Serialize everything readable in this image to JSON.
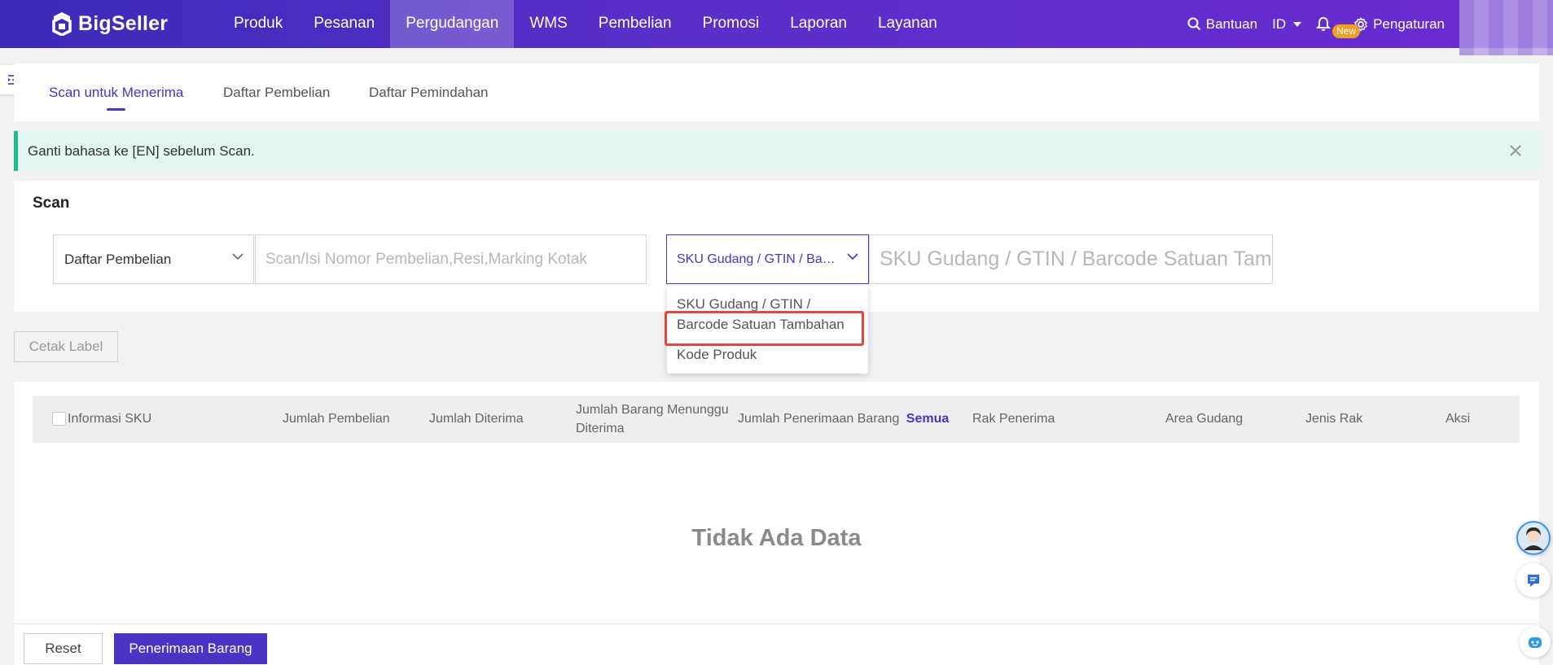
{
  "app": {
    "logo_text": "BigSeller"
  },
  "nav": {
    "items": [
      {
        "label": "Produk"
      },
      {
        "label": "Pesanan"
      },
      {
        "label": "Pergudangan",
        "active": true
      },
      {
        "label": "WMS"
      },
      {
        "label": "Pembelian"
      },
      {
        "label": "Promosi"
      },
      {
        "label": "Laporan"
      },
      {
        "label": "Layanan"
      }
    ],
    "help_label": "Bantuan",
    "language": "ID",
    "new_badge": "New",
    "settings_label": "Pengaturan"
  },
  "tabs": [
    {
      "label": "Scan untuk Menerima",
      "active": true
    },
    {
      "label": "Daftar Pembelian"
    },
    {
      "label": "Daftar Pemindahan"
    }
  ],
  "alert": {
    "text": "Ganti bahasa ke [EN] sebelum Scan."
  },
  "scan": {
    "title": "Scan",
    "source_select": {
      "value": "Daftar Pembelian"
    },
    "order_input": {
      "placeholder": "Scan/Isi Nomor Pembelian,Resi,Marking Kotak",
      "value": ""
    },
    "sku_select": {
      "value": "SKU Gudang / GTIN / Barcode Satuan Tambahan"
    },
    "sku_input": {
      "placeholder": "SKU Gudang / GTIN / Barcode Satuan Tambahan",
      "value": ""
    },
    "dropdown_options": [
      {
        "line1": "SKU Gudang / GTIN /",
        "line2": "Barcode Satuan Tambahan"
      },
      {
        "line1": "Kode Produk"
      }
    ]
  },
  "actions": {
    "print_label": "Cetak Label"
  },
  "table": {
    "columns": [
      "Informasi SKU",
      "Jumlah Pembelian",
      "Jumlah Diterima",
      "Jumlah Barang Menunggu Diterima",
      "Jumlah Penerimaan Barang",
      "Rak Penerima",
      "Area Gudang",
      "Jenis Rak",
      "Aksi"
    ],
    "all_link": "Semua",
    "empty_text": "Tidak Ada Data"
  },
  "footer": {
    "reset_label": "Reset",
    "receive_label": "Penerimaan Barang"
  },
  "colors": {
    "primary": "#4b34c4",
    "success": "#1dbc8e",
    "alert_bg": "#e3f6f1",
    "highlight": "#e0483e",
    "badge": "#f0a020"
  }
}
